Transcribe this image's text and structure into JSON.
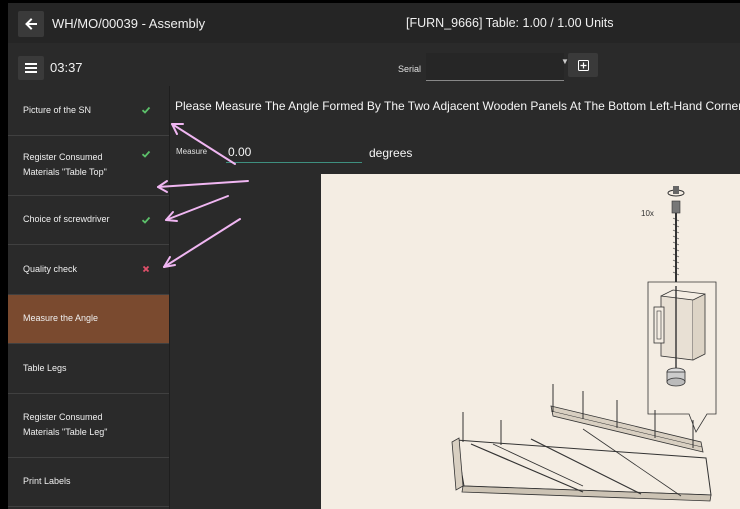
{
  "header": {
    "title": "WH/MO/00039 - Assembly",
    "product": "[FURN_9666] Table: 1.00 / 1.00 Units"
  },
  "subbar": {
    "timer": "03:37",
    "serial_label": "Serial",
    "serial_value": ""
  },
  "steps": [
    {
      "label": "Picture of the SN",
      "status": "done"
    },
    {
      "label": "Register Consumed Materials \"Table Top\"",
      "status": "done"
    },
    {
      "label": "Choice of screwdriver",
      "status": "done"
    },
    {
      "label": "Quality check",
      "status": "failed"
    },
    {
      "label": "Measure the Angle",
      "status": "active"
    },
    {
      "label": "Table Legs",
      "status": "pending"
    },
    {
      "label": "Register Consumed Materials \"Table Leg\"",
      "status": "pending"
    },
    {
      "label": "Print Labels",
      "status": "pending"
    }
  ],
  "main": {
    "instruction": "Please Measure The Angle Formed By The Two Adjacent Wooden Panels At The Bottom Left-Hand Corner.",
    "measure_label": "Measure",
    "measure_value": "0.00",
    "measure_unit": "degrees"
  },
  "worksheet": {
    "quantity_text": "10x"
  },
  "icons": {
    "back": "arrow-left-icon",
    "menu": "hamburger-menu-icon",
    "serial_add": "plus-square-icon",
    "done": "checkmark-icon",
    "failed": "cross-icon"
  },
  "colors": {
    "active_step": "#7a4a2f",
    "done": "#5cc06a",
    "failed": "#e0506a",
    "annotation_arrow": "#f0b6f2",
    "input_underline": "#3e8f7f"
  }
}
